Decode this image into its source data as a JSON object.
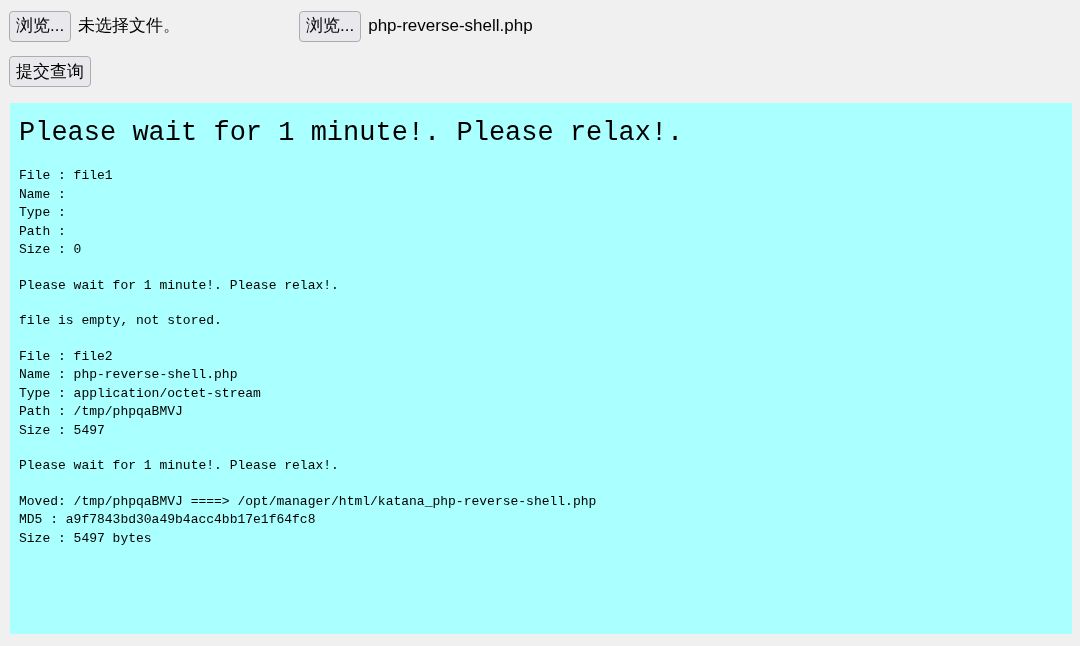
{
  "file_inputs": [
    {
      "button": "浏览...",
      "file": "未选择文件。"
    },
    {
      "button": "浏览...",
      "file": "php-reverse-shell.php"
    }
  ],
  "submit_button": "提交查询",
  "output": {
    "heading": "Please wait for 1 minute!. Please relax!.",
    "blocks": [
      [
        "File : file1",
        "Name :",
        "Type :",
        "Path :",
        "Size : 0"
      ],
      [
        "Please wait for 1 minute!. Please relax!."
      ],
      [
        "file is empty, not stored."
      ],
      [
        "File : file2",
        "Name : php-reverse-shell.php",
        "Type : application/octet-stream",
        "Path : /tmp/phpqaBMVJ",
        "Size : 5497"
      ],
      [
        "Please wait for 1 minute!. Please relax!."
      ],
      [
        "Moved: /tmp/phpqaBMVJ ====> /opt/manager/html/katana_php-reverse-shell.php",
        "MD5 : a9f7843bd30a49b4acc4bb17e1f64fc8",
        "Size : 5497 bytes"
      ]
    ]
  }
}
